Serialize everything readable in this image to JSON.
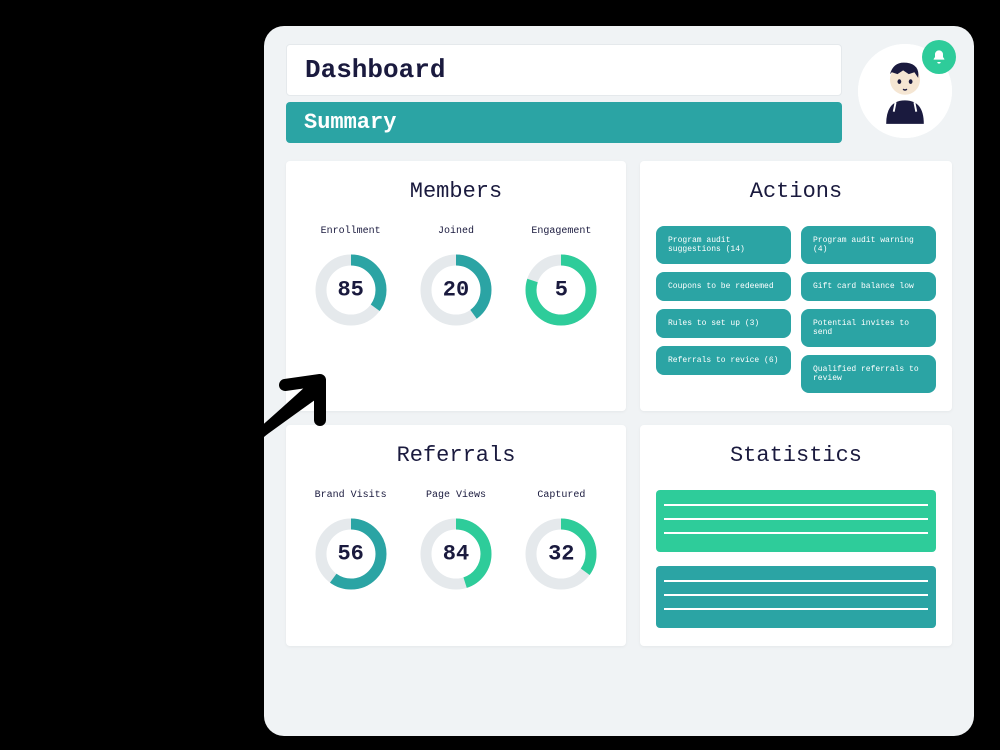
{
  "header": {
    "title": "Dashboard",
    "subtitle": "Summary"
  },
  "colors": {
    "teal": "#2ba4a4",
    "green": "#2ecc9a",
    "navy": "#1a1a3e",
    "grey": "#e5e9ec"
  },
  "members": {
    "title": "Members",
    "items": [
      {
        "label": "Enrollment",
        "value": 85,
        "percent": 35,
        "color": "#2ba4a4"
      },
      {
        "label": "Joined",
        "value": 20,
        "percent": 40,
        "color": "#2ba4a4"
      },
      {
        "label": "Engagement",
        "value": 5,
        "percent": 80,
        "color": "#2ecc9a"
      }
    ]
  },
  "referrals": {
    "title": "Referrals",
    "items": [
      {
        "label": "Brand Visits",
        "value": 56,
        "percent": 60,
        "color": "#2ba4a4"
      },
      {
        "label": "Page Views",
        "value": 84,
        "percent": 45,
        "color": "#2ecc9a"
      },
      {
        "label": "Captured",
        "value": 32,
        "percent": 35,
        "color": "#2ecc9a"
      }
    ]
  },
  "actions": {
    "title": "Actions",
    "left": [
      "Program audit suggestions (14)",
      "Coupons to be redeemed",
      "Rules to set up (3)",
      "Referrals to revice (6)"
    ],
    "right": [
      "Program audit warning (4)",
      "Gift card balance low",
      "Potential invites to send",
      "Qualified referrals to review"
    ]
  },
  "statistics": {
    "title": "Statistics",
    "blocks": [
      {
        "color": "#2ecc9a"
      },
      {
        "color": "#2ba4a4"
      }
    ]
  },
  "chart_data": [
    {
      "type": "pie",
      "title": "Members",
      "series": [
        {
          "name": "Enrollment",
          "values": [
            85
          ],
          "percent": 35
        },
        {
          "name": "Joined",
          "values": [
            20
          ],
          "percent": 40
        },
        {
          "name": "Engagement",
          "values": [
            5
          ],
          "percent": 80
        }
      ]
    },
    {
      "type": "pie",
      "title": "Referrals",
      "series": [
        {
          "name": "Brand Visits",
          "values": [
            56
          ],
          "percent": 60
        },
        {
          "name": "Page Views",
          "values": [
            84
          ],
          "percent": 45
        },
        {
          "name": "Captured",
          "values": [
            32
          ],
          "percent": 35
        }
      ]
    }
  ]
}
